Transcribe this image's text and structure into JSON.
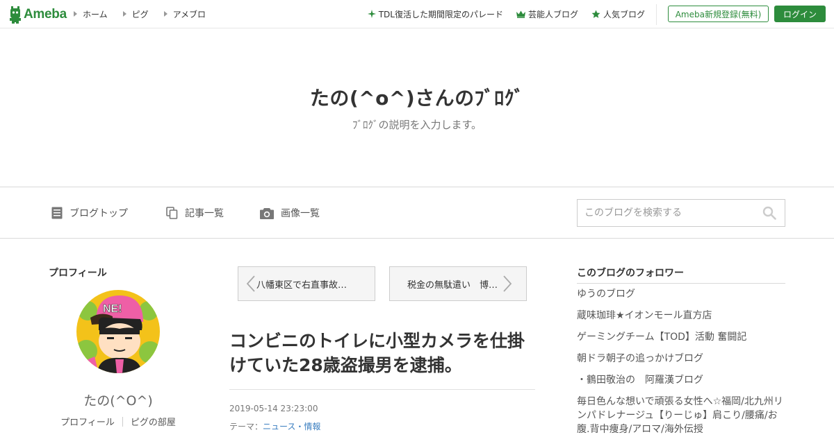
{
  "topbar": {
    "logo_text": "Ameba",
    "nav": [
      {
        "label": "ホーム"
      },
      {
        "label": "ピグ"
      },
      {
        "label": "アメブロ"
      }
    ],
    "trend": [
      {
        "label": "TDL復活した期間限定のパレード",
        "icon": "sparkle-icon"
      },
      {
        "label": "芸能人ブログ",
        "icon": "crown-icon"
      },
      {
        "label": "人気ブログ",
        "icon": "star-icon"
      }
    ],
    "register_label": "Ameba新規登録(無料)",
    "login_label": "ログイン",
    "brand_color": "#2d8c3c"
  },
  "header": {
    "title": "たの(^o^)さんのﾌﾞﾛｸﾞ",
    "description": "ﾌﾞﾛｸﾞの説明を入力します。"
  },
  "blognav": {
    "items": [
      {
        "label": "ブログトップ",
        "icon": "document-icon"
      },
      {
        "label": "記事一覧",
        "icon": "copy-icon"
      },
      {
        "label": "画像一覧",
        "icon": "camera-icon"
      }
    ],
    "search_placeholder": "このブログを検索する"
  },
  "profile": {
    "heading": "プロフィール",
    "name": "たの(^O^)",
    "links": [
      "プロフィール",
      "ピグの部屋"
    ]
  },
  "article": {
    "prev_title": "八幡東区で右直事故…",
    "next_title": "税金の無駄遣い　博…",
    "title": "コンビニのトイレに小型カメラを仕掛けていた28歳盗撮男を逮捕。",
    "date": "2019-05-14 23:23:00",
    "theme_label": "テーマ：",
    "theme": "ニュース・情報"
  },
  "followers": {
    "heading": "このブログのフォロワー",
    "items": [
      "ゆうのブログ",
      "蔵味珈琲★イオンモール直方店",
      "ゲーミングチーム【TOD】活動 奮闘記",
      "朝ドラ朝子の追っかけブログ",
      "・鶴田敬治の　阿羅漢ブログ",
      "毎日色んな想いで頑張る女性へ☆福岡/北九州リンパドレナージュ【りーじゅ】肩こり/腰痛/お腹.背中痩身/アロマ/海外伝授"
    ]
  }
}
